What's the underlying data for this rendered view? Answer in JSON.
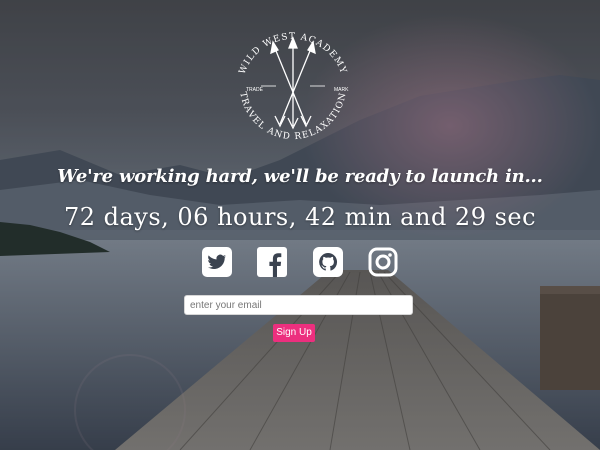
{
  "logo": {
    "top_text": "WILD WEST ACADEMY",
    "bottom_text": "TRAVEL AND RELAXATION",
    "left_small": "TRADE",
    "right_small": "MARK"
  },
  "headline": "We're working hard, we'll be ready to launch in...",
  "countdown": "72 days, 06 hours, 42 min and 29 sec",
  "social": {
    "icons": [
      "twitter-icon",
      "facebook-icon",
      "github-icon",
      "instagram-icon"
    ]
  },
  "form": {
    "email_placeholder": "enter your email",
    "signup_label": "Sign Up"
  },
  "colors": {
    "accent": "#ec2f7e",
    "text": "#ffffff"
  }
}
